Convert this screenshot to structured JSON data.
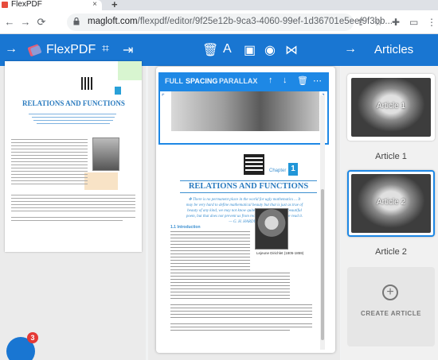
{
  "browser": {
    "tab_title": "FlexPDF",
    "tab_close": "×",
    "new_tab": "+",
    "url_main": "magloft.com",
    "url_path": "/flexpdf/editor/9f25e12b-9ca3-4060-99ef-1d36701e5ee/9f3bb..."
  },
  "toolbar": {
    "brand": "FlexPDF",
    "articles_title": "Articles"
  },
  "selection_toolbar": {
    "full": "FULL",
    "spacing": "SPACING",
    "parallax": "PARALLAX"
  },
  "page": {
    "chapter_label": "Chapter",
    "chapter_number": "1",
    "title": "RELATIONS AND FUNCTIONS",
    "quote": "✥ There is no permanent place in the world for ugly mathematics ... It may be very hard to define mathematical beauty but that is just as true of beauty of any kind, we may not know quite what we mean by a beautiful poem, but that does not prevent us from recognising one when we read it. — G. H. HARDY ✥",
    "section_heading": "1.1 Introduction",
    "portrait_caption": "Lejeune Dirichlet (1805-1859)"
  },
  "thumbnail": {
    "title": "RELATIONS AND FUNCTIONS"
  },
  "chat": {
    "badge": "3"
  },
  "articles": [
    {
      "label": "Article 1",
      "overlay": "Article 1",
      "selected": false
    },
    {
      "label": "Article 2",
      "overlay": "Article 2",
      "selected": true
    }
  ],
  "create_article": "CREATE ARTICLE",
  "colors": {
    "primary": "#1976d2",
    "accent": "#1e88e5",
    "title_blue": "#2a7bbf"
  }
}
